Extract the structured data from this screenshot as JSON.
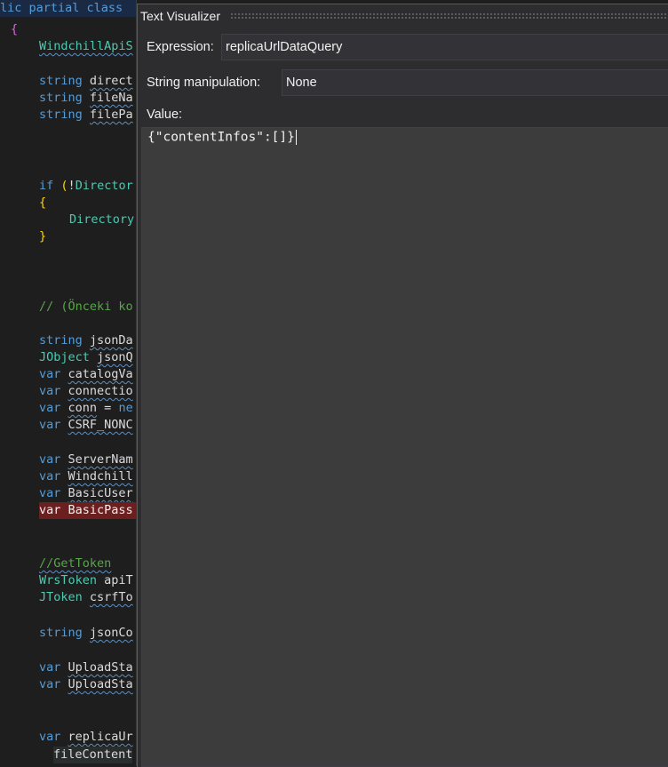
{
  "editor": {
    "lines": [
      [
        "lic partial class ",
        "{",
        "WindchillApiS",
        "string direct",
        "string fileNa",
        "string filePa"
      ],
      [
        "if (!Director",
        "{",
        "Directory",
        "}"
      ],
      [
        "// (Önceki ko"
      ],
      [
        "string jsonDa",
        "JObject jsonQ",
        "var catalogVa",
        "var connectio",
        "var conn = ne",
        "var CSRF_NONC"
      ],
      [
        "var ServerNam",
        "var Windchill",
        "var BasicUser",
        "var BasicPass"
      ],
      [
        "//GetToken",
        "WrsToken apiT",
        "JToken csrfTo"
      ],
      [
        "string jsonCo"
      ],
      [
        "var UploadSta",
        "var UploadSta"
      ],
      [
        "var replicaUr",
        "fileContent"
      ]
    ]
  },
  "visualizer": {
    "title": "Text Visualizer",
    "expression_label": "Expression:",
    "expression_value": "replicaUrlDataQuery",
    "manipulation_label": "String manipulation:",
    "manipulation_value": "None",
    "value_label": "Value:",
    "value_text": "{\"contentInfos\":[]}"
  }
}
